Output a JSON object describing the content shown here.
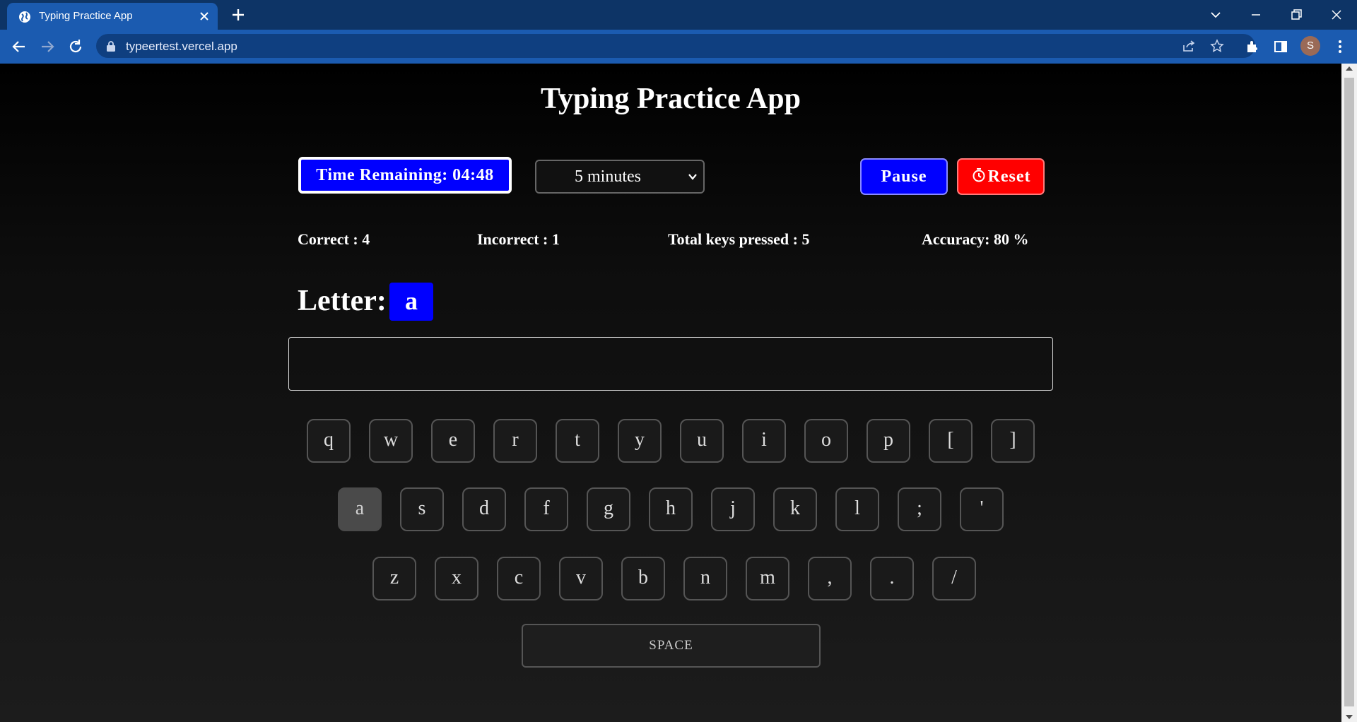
{
  "browser": {
    "tab_title": "Typing Practice App",
    "url": "typeertest.vercel.app",
    "profile_initial": "S",
    "accent_color": "#1b5bb0"
  },
  "app": {
    "title": "Typing Practice App",
    "timer_text": "Time Remaining: 04:48",
    "duration_selected": "5 minutes",
    "pause_label": "Pause",
    "reset_label": "Reset",
    "stats": {
      "correct": "Correct : 4",
      "incorrect": "Incorrect : 1",
      "total": "Total keys pressed : 5",
      "accuracy": "Accuracy: 80 %"
    },
    "letter_label": "Letter:",
    "current_letter": "a",
    "input_value": "",
    "colors": {
      "timer": "#0000ff",
      "pause": "#0000ff",
      "reset": "#ff0000",
      "letter": "#0000ff"
    }
  },
  "keyboard": {
    "row1": [
      "q",
      "w",
      "e",
      "r",
      "t",
      "y",
      "u",
      "i",
      "o",
      "p",
      "[",
      "]"
    ],
    "row2": [
      "a",
      "s",
      "d",
      "f",
      "g",
      "h",
      "j",
      "k",
      "l",
      ";",
      "'"
    ],
    "row3": [
      "z",
      "x",
      "c",
      "v",
      "b",
      "n",
      "m",
      ",",
      ".",
      "/"
    ],
    "space_label": "SPACE",
    "active_key": "a"
  }
}
